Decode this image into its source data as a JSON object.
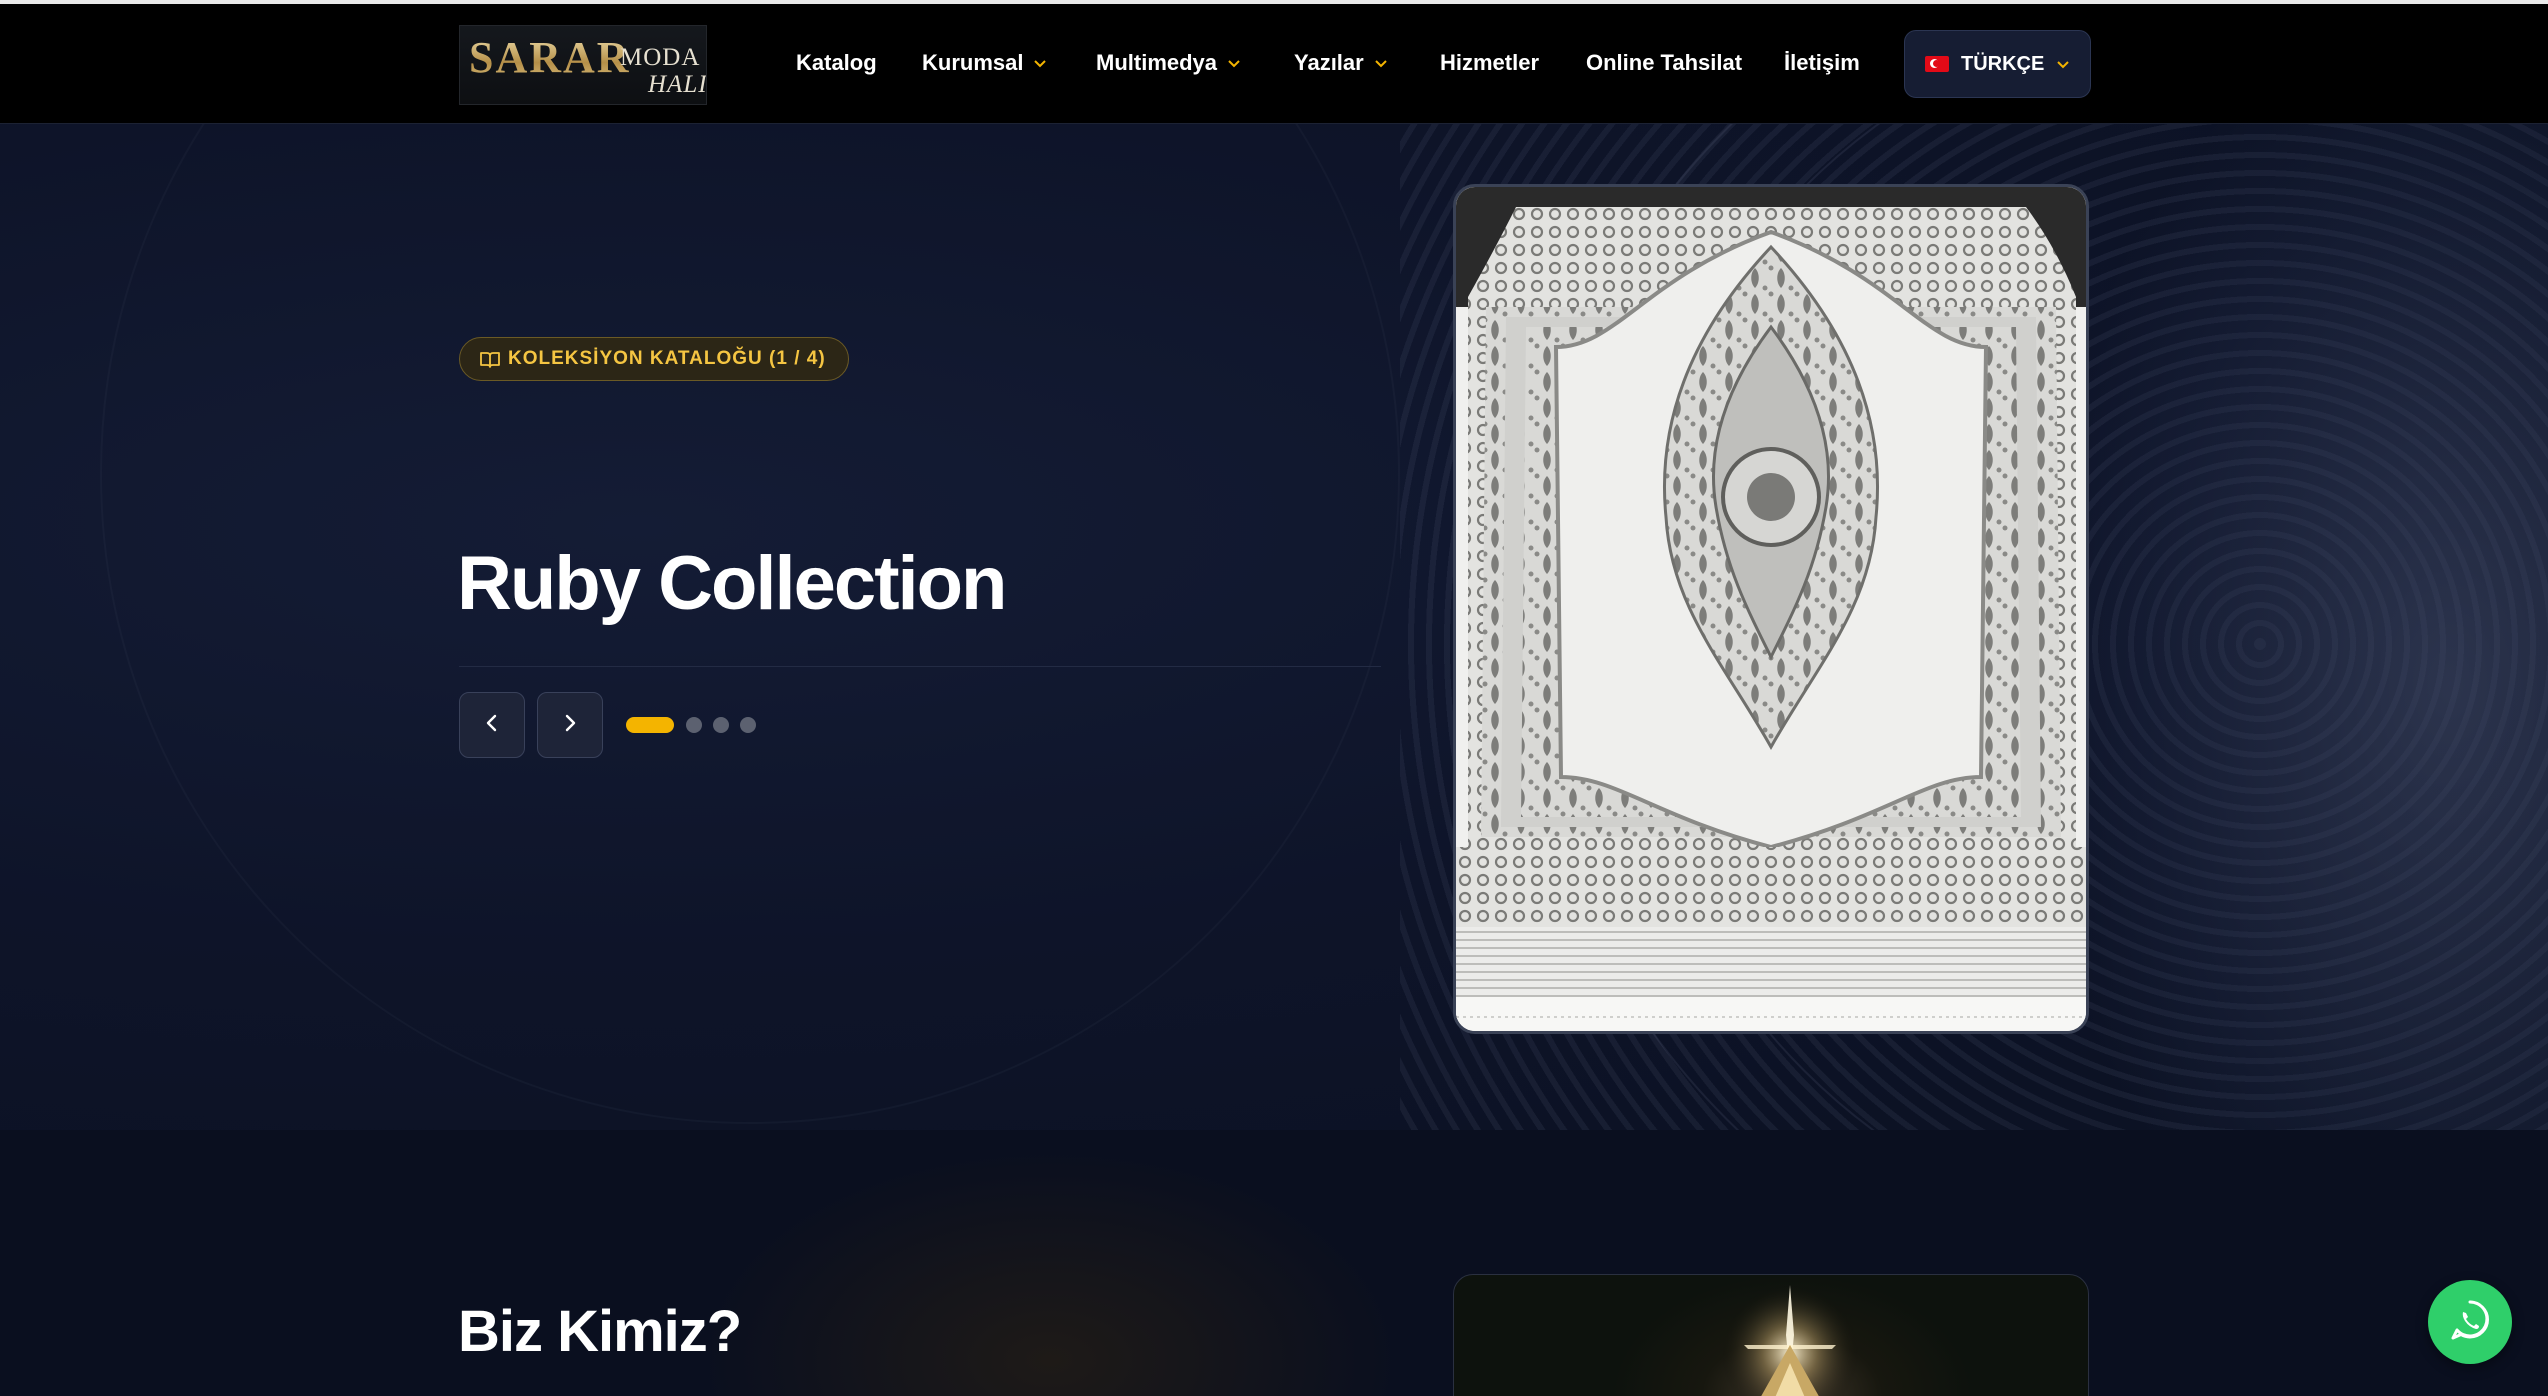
{
  "brand": {
    "logo_main": "SARAR",
    "logo_sub1": "MODA",
    "logo_sub2": "HALI"
  },
  "nav": {
    "items": [
      {
        "label": "Katalog",
        "has_dropdown": false
      },
      {
        "label": "Kurumsal",
        "has_dropdown": true
      },
      {
        "label": "Multimedya",
        "has_dropdown": true
      },
      {
        "label": "Yazılar",
        "has_dropdown": true
      },
      {
        "label": "Hizmetler",
        "has_dropdown": false
      },
      {
        "label": "Online Tahsilat",
        "has_dropdown": false
      },
      {
        "label": "İletişim",
        "has_dropdown": false
      }
    ],
    "language": {
      "label": "TÜRKÇE",
      "flag": "turkey-flag"
    }
  },
  "hero": {
    "badge": "KOLEKSİYON KATALOĞU (1 / 4)",
    "badge_icon": "book-icon",
    "title": "Ruby Collection",
    "slides": {
      "current": 1,
      "total": 4
    },
    "image_alt": "carpet-image"
  },
  "about": {
    "title": "Biz Kimiz?"
  },
  "colors": {
    "accent": "#f4b400",
    "background": "#0b1122",
    "header": "#000000",
    "whatsapp": "#2fcf6a"
  }
}
